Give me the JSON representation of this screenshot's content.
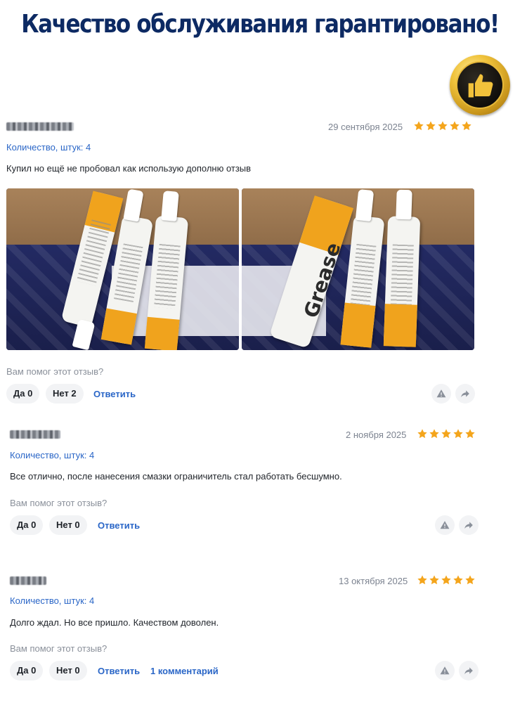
{
  "banner": {
    "title": "Качество обслуживания гарантировано!"
  },
  "colors": {
    "star": "#f4a51c",
    "link": "#2a66c7",
    "banner": "#0d2a63"
  },
  "reviews": [
    {
      "date": "29 сентября 2025",
      "rating": 5,
      "quantity": "Количество, штук: 4",
      "text": "Купил но ещё не пробовал как использую дополню отзыв",
      "helpful_question": "Вам помог этот отзыв?",
      "yes": "Да 0",
      "no": "Нет 2",
      "reply": "Ответить",
      "photos": [
        {
          "tube_text": ""
        },
        {
          "tube_text": "Grease"
        }
      ]
    },
    {
      "date": "2 ноября 2025",
      "rating": 5,
      "quantity": "Количество, штук: 4",
      "text": "Все отлично, после нанесения смазки ограничитель стал работать бесшумно.",
      "helpful_question": "Вам помог этот отзыв?",
      "yes": "Да 0",
      "no": "Нет 0",
      "reply": "Ответить"
    },
    {
      "date": "13 октября 2025",
      "rating": 5,
      "quantity": "Количество, штук: 4",
      "text": "Долго ждал. Но все пришло. Качеством доволен.",
      "helpful_question": "Вам помог этот отзыв?",
      "yes": "Да 0",
      "no": "Нет 0",
      "reply": "Ответить",
      "comments": "1 комментарий"
    }
  ],
  "icons": {
    "report": "warning-triangle-icon",
    "share": "share-arrow-icon",
    "badge": "thumbs-up-icon"
  }
}
